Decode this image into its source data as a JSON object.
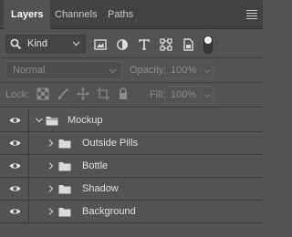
{
  "tabs": [
    {
      "label": "Layers",
      "active": true
    },
    {
      "label": "Channels",
      "active": false
    },
    {
      "label": "Paths",
      "active": false
    }
  ],
  "filter": {
    "kind_label": "Kind",
    "icons": [
      "pixel-filter-icon",
      "adjustment-filter-icon",
      "type-filter-icon",
      "shape-filter-icon",
      "smart-object-filter-icon"
    ]
  },
  "blend": {
    "mode_label": "Normal",
    "opacity_label": "Opacity:",
    "opacity_value": "100%"
  },
  "lock": {
    "label": "Lock:",
    "fill_label": "Fill:",
    "fill_value": "100%"
  },
  "layers": [
    {
      "name": "Mockup",
      "type": "group",
      "expanded": true,
      "visible": true,
      "depth": 0
    },
    {
      "name": "Outside Pills",
      "type": "group",
      "expanded": false,
      "visible": true,
      "depth": 1
    },
    {
      "name": "Bottle",
      "type": "group",
      "expanded": false,
      "visible": true,
      "depth": 1
    },
    {
      "name": "Shadow",
      "type": "group",
      "expanded": false,
      "visible": true,
      "depth": 1
    },
    {
      "name": "Background",
      "type": "group",
      "expanded": false,
      "visible": true,
      "depth": 1
    }
  ],
  "colors": {
    "panel_bg": "#535353",
    "tabbar_bg": "#424242",
    "text": "#e0e0e0",
    "disabled_text": "#8c8c8c"
  }
}
